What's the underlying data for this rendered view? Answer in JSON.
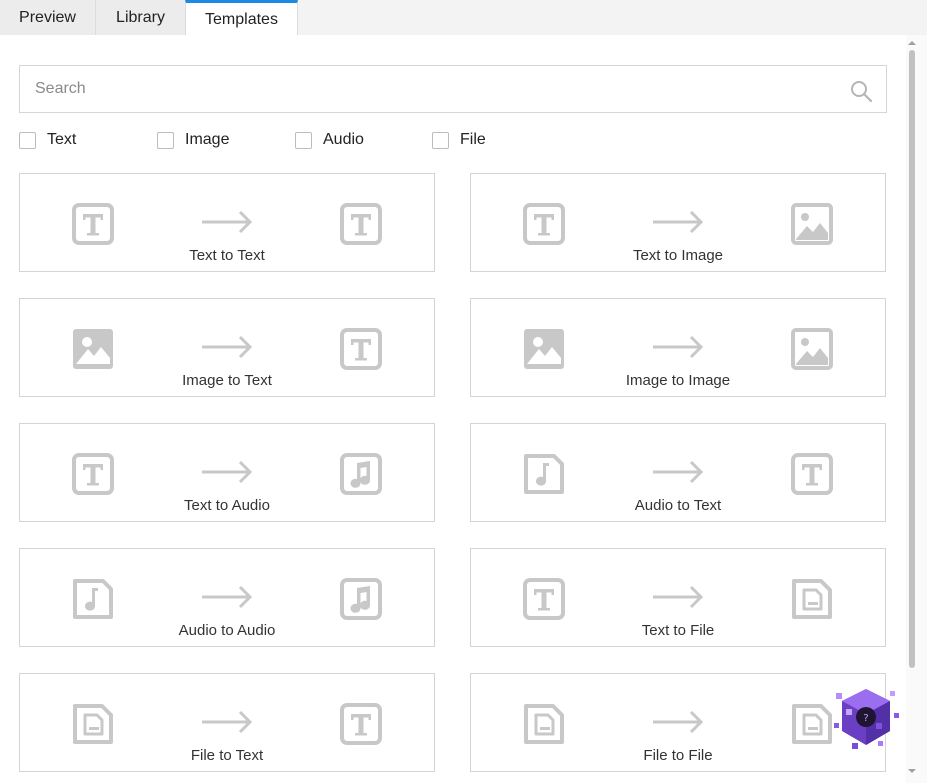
{
  "tabs": [
    {
      "label": "Preview"
    },
    {
      "label": "Library"
    },
    {
      "label": "Templates"
    }
  ],
  "search": {
    "placeholder": "Search",
    "value": ""
  },
  "filters": [
    {
      "label": "Text",
      "checked": false
    },
    {
      "label": "Image",
      "checked": false
    },
    {
      "label": "Audio",
      "checked": false
    },
    {
      "label": "File",
      "checked": false
    }
  ],
  "templates": [
    {
      "label": "Text to Text",
      "from_icon": "text-icon",
      "to_icon": "text-icon"
    },
    {
      "label": "Text to Image",
      "from_icon": "text-icon",
      "to_icon": "image-icon"
    },
    {
      "label": "Image to Text",
      "from_icon": "image-icon",
      "to_icon": "text-icon"
    },
    {
      "label": "Image to Image",
      "from_icon": "image-icon",
      "to_icon": "image-icon"
    },
    {
      "label": "Text to Audio",
      "from_icon": "text-icon",
      "to_icon": "audio-icon"
    },
    {
      "label": "Audio to Text",
      "from_icon": "audio-icon",
      "to_icon": "text-icon"
    },
    {
      "label": "Audio to Audio",
      "from_icon": "audio-icon",
      "to_icon": "audio-icon"
    },
    {
      "label": "Text to File",
      "from_icon": "text-icon",
      "to_icon": "file-icon"
    },
    {
      "label": "File to Text",
      "from_icon": "file-icon",
      "to_icon": "text-icon"
    },
    {
      "label": "File to File",
      "from_icon": "file-icon",
      "to_icon": "file-icon"
    }
  ],
  "colors": {
    "accent": "#1e88e5",
    "icon_gray": "#c8c8c8",
    "card_border": "#d4d4d4"
  }
}
